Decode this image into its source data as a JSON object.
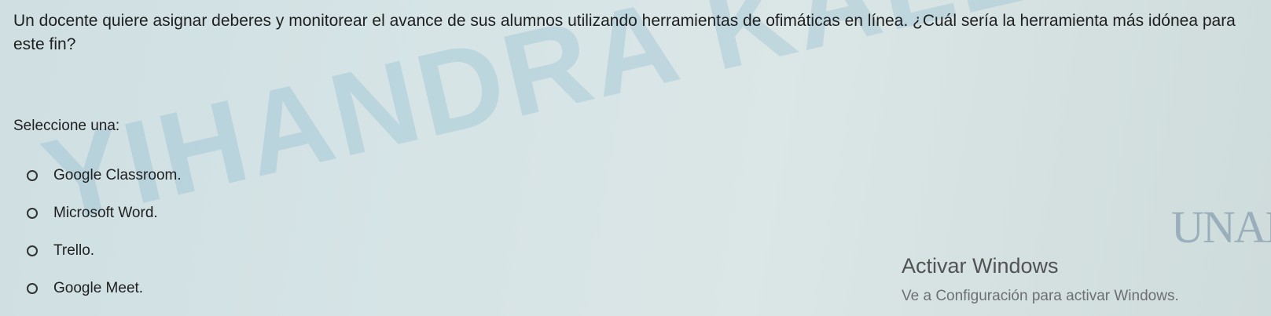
{
  "question": {
    "text": "Un docente quiere asignar deberes y monitorear el avance de sus alumnos utilizando herramientas de ofimáticas en línea. ¿Cuál sería la herramienta más idónea para este fin?"
  },
  "prompt": {
    "label": "Seleccione una:"
  },
  "options": [
    {
      "label": "Google Classroom."
    },
    {
      "label": "Microsoft Word."
    },
    {
      "label": "Trello."
    },
    {
      "label": "Google Meet."
    }
  ],
  "watermark": {
    "text": "YIHANDRA KALENA IBARRA LOCARNO"
  },
  "logo": {
    "text": "UNAD"
  },
  "windows_activation": {
    "title": "Activar Windows",
    "subtitle": "Ve a Configuración para activar Windows."
  }
}
